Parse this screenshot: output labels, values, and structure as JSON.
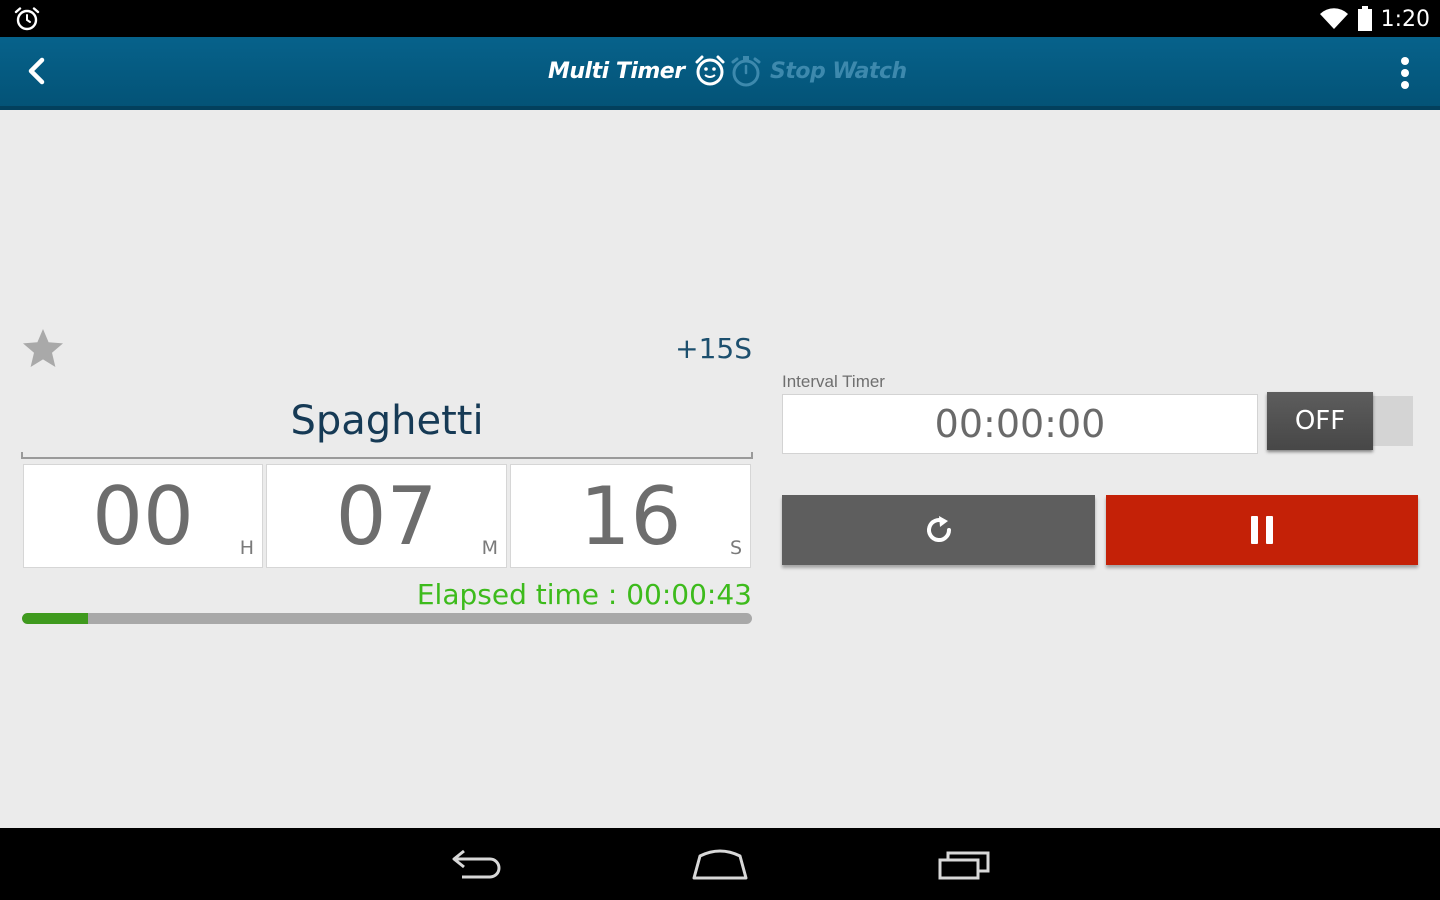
{
  "status_bar": {
    "time": "1:20",
    "icons": [
      "alarm-icon",
      "wifi-icon",
      "battery-icon"
    ]
  },
  "action_bar": {
    "back_icon": "chevron-left-icon",
    "tabs": [
      {
        "label": "Multi Timer",
        "icon": "alarm-clock-icon",
        "active": true
      },
      {
        "label": "Stop Watch",
        "icon": "stopwatch-icon",
        "active": false
      }
    ],
    "menu_icon": "overflow-menu-icon"
  },
  "timer": {
    "favorite_icon": "star-icon",
    "add_time_label": "+15S",
    "name": "Spaghetti",
    "hours": "00",
    "hours_unit": "H",
    "minutes": "07",
    "minutes_unit": "M",
    "seconds": "16",
    "seconds_unit": "S",
    "elapsed_text": "Elapsed time : 00:00:43",
    "progress_fraction": 0.09
  },
  "interval": {
    "label": "Interval Timer",
    "value": "00:00:00",
    "toggle_label": "OFF"
  },
  "controls": {
    "reset_icon": "refresh-icon",
    "pause_icon": "pause-icon"
  },
  "nav_bar": {
    "icons": [
      "back-icon",
      "home-icon",
      "recents-icon"
    ]
  },
  "colors": {
    "action_bar": "#05577e",
    "elapsed_text": "#3dbb1c",
    "progress_fill": "#3f9a1e",
    "pause_button": "#c42107",
    "reset_button": "#5e5e5e"
  }
}
